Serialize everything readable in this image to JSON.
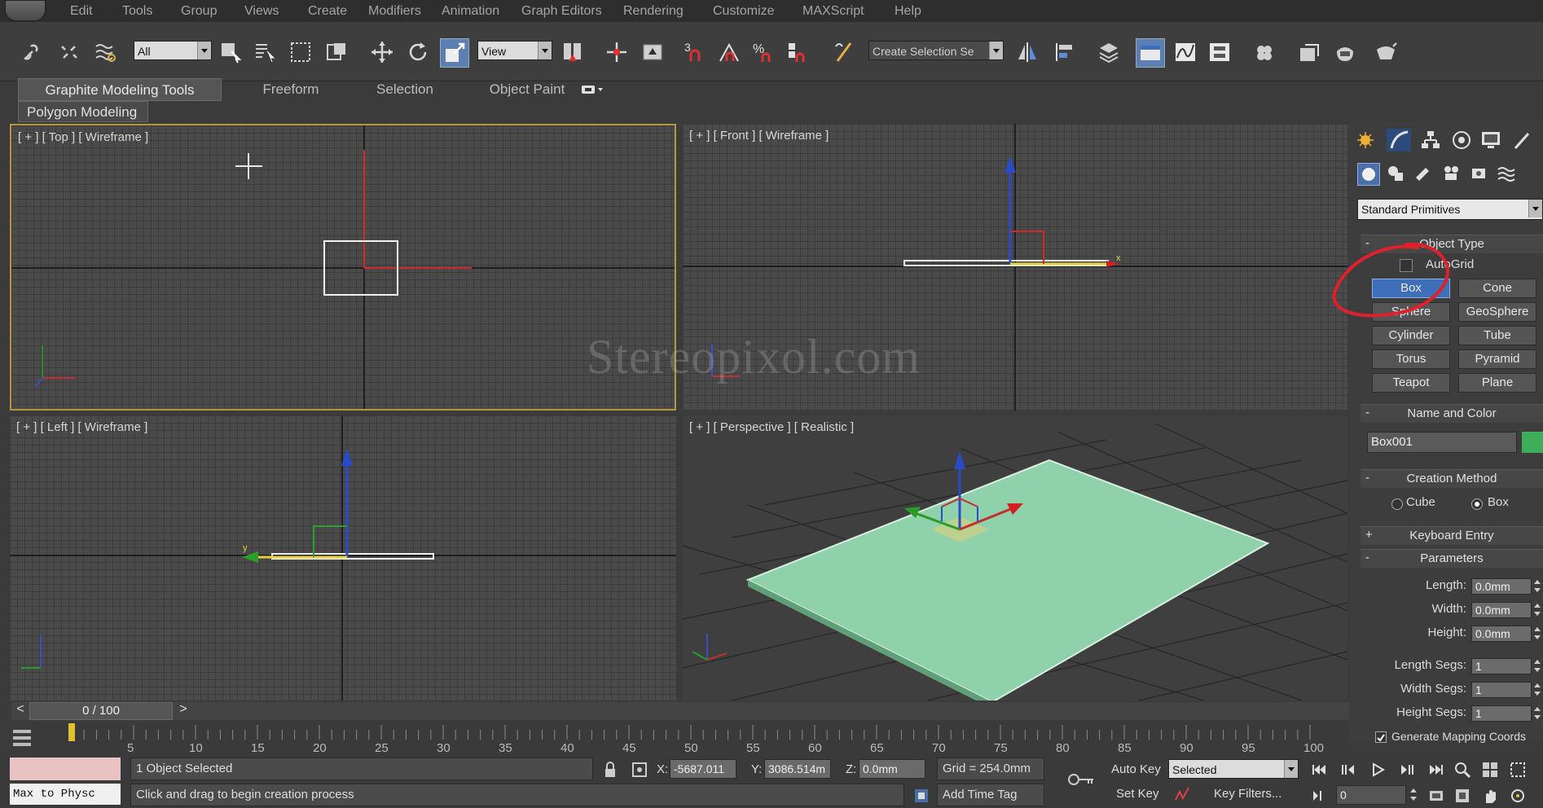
{
  "menu": [
    "Edit",
    "Tools",
    "Group",
    "Views",
    "Create",
    "Modifiers",
    "Animation",
    "Graph Editors",
    "Rendering",
    "Customize",
    "MAXScript",
    "Help"
  ],
  "toolbar": {
    "filter_value": "All",
    "coord_system": "View",
    "named_selection": "Create Selection Se",
    "snap_angle": "3",
    "snap_percent": "%"
  },
  "ribbon": {
    "tabs": [
      "Graphite Modeling Tools",
      "Freeform",
      "Selection",
      "Object Paint"
    ],
    "panel": "Polygon Modeling"
  },
  "viewports": {
    "top": "[ + ] [ Top ] [ Wireframe ]",
    "front": "[ + ] [ Front ] [ Wireframe ]",
    "left": "[ + ] [ Left ] [ Wireframe ]",
    "perspective": "[ + ] [ Perspective ] [ Realistic ]"
  },
  "watermark": "Stereopixol.com",
  "command_panel": {
    "category": "Standard Primitives",
    "object_type_title": "Object Type",
    "autogrid": "AutoGrid",
    "buttons": [
      "Box",
      "Cone",
      "Sphere",
      "GeoSphere",
      "Cylinder",
      "Tube",
      "Torus",
      "Pyramid",
      "Teapot",
      "Plane"
    ],
    "name_color_title": "Name and Color",
    "object_name": "Box001",
    "object_color": "#3fae5a",
    "creation_method_title": "Creation Method",
    "creation_options": [
      "Cube",
      "Box"
    ],
    "keyboard_entry_title": "Keyboard Entry",
    "parameters_title": "Parameters",
    "params": [
      {
        "label": "Length:",
        "value": "0.0mm"
      },
      {
        "label": "Width:",
        "value": "0.0mm"
      },
      {
        "label": "Height:",
        "value": "0.0mm"
      }
    ],
    "segs": [
      {
        "label": "Length Segs:",
        "value": "1"
      },
      {
        "label": "Width Segs:",
        "value": "1"
      },
      {
        "label": "Height Segs:",
        "value": "1"
      }
    ],
    "gen_mapping": "Generate Mapping Coords"
  },
  "timeline": {
    "frame": "0 / 100",
    "ticks": [
      "5",
      "10",
      "15",
      "20",
      "25",
      "30",
      "35",
      "40",
      "45",
      "50",
      "55",
      "60",
      "65",
      "70",
      "75",
      "80",
      "85",
      "90",
      "95",
      "100"
    ]
  },
  "status": {
    "script_label": "Max to Physc",
    "selected": "1 Object Selected",
    "prompt": "Click and drag to begin creation process",
    "x_label": "X:",
    "x_value": "-5687.011",
    "y_label": "Y:",
    "y_value": "3086.514m",
    "z_label": "Z:",
    "z_value": "0.0mm",
    "grid": "Grid = 254.0mm",
    "auto_key": "Auto Key",
    "key_mode": "Selected",
    "set_key": "Set Key",
    "key_filters": "Key Filters...",
    "add_time_tag": "Add Time Tag",
    "current_frame": "0"
  },
  "colors": {
    "ui_bg": "#3b3b3b",
    "active_viewport_border": "#b59740",
    "selected_button": "#3e6fb8",
    "annotation": "#e0202a",
    "box_color": "#8fd1aa"
  }
}
